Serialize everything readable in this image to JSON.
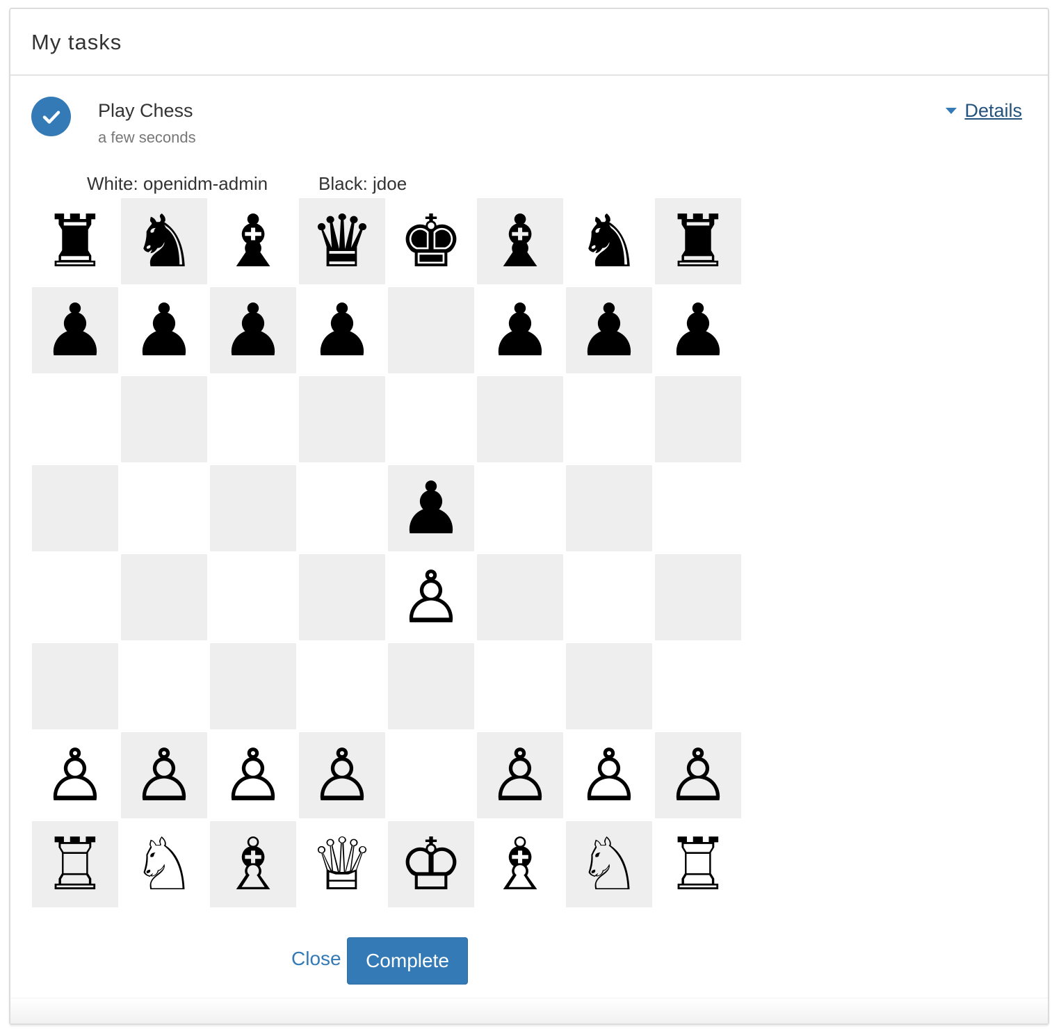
{
  "panel": {
    "title": "My tasks"
  },
  "task": {
    "name": "Play Chess",
    "time": "a few seconds",
    "details_label": "Details",
    "check_icon": "check-circle-icon",
    "caret_icon": "caret-down-icon"
  },
  "game": {
    "white_label": "White: openidm-admin",
    "black_label": "Black: jdoe",
    "board": [
      [
        "♜",
        "♞",
        "♝",
        "♛",
        "♚",
        "♝",
        "♞",
        "♜"
      ],
      [
        "♟",
        "♟",
        "♟",
        "♟",
        "",
        "♟",
        "♟",
        "♟"
      ],
      [
        "",
        "",
        "",
        "",
        "",
        "",
        "",
        ""
      ],
      [
        "",
        "",
        "",
        "",
        "♟",
        "",
        "",
        ""
      ],
      [
        "",
        "",
        "",
        "",
        "♙",
        "",
        "",
        ""
      ],
      [
        "",
        "",
        "",
        "",
        "",
        "",
        "",
        ""
      ],
      [
        "♙",
        "♙",
        "♙",
        "♙",
        "",
        "♙",
        "♙",
        "♙"
      ],
      [
        "♖",
        "♘",
        "♗",
        "♕",
        "♔",
        "♗",
        "♘",
        "♖"
      ]
    ]
  },
  "actions": {
    "close_label": "Close",
    "complete_label": "Complete"
  },
  "colors": {
    "primary": "#337ab7",
    "link": "#23527c",
    "dark_square": "#eeeeee",
    "light_square": "#ffffff"
  }
}
